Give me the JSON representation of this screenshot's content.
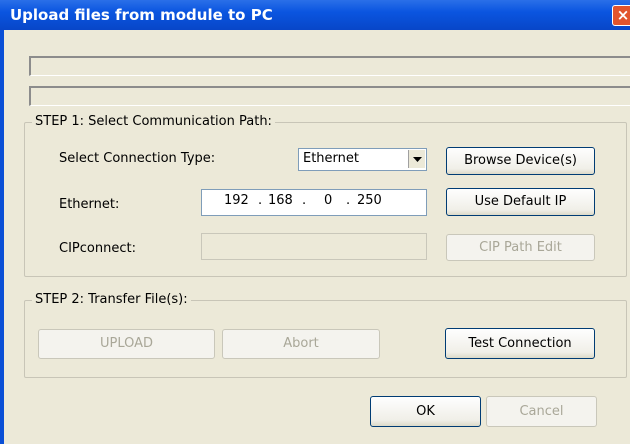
{
  "window": {
    "title": "Upload files from module to PC",
    "close_glyph": "×"
  },
  "step1": {
    "legend": "STEP 1: Select Communication Path:",
    "connection_type_label": "Select Connection Type:",
    "connection_type_value": "Ethernet",
    "browse_button": "Browse Device(s)",
    "ethernet_label": "Ethernet:",
    "ip": [
      "192",
      "168",
      "0",
      "250"
    ],
    "ip_separator": ".",
    "use_default_button": "Use Default IP",
    "cipconnect_label": "CIPconnect:",
    "cipconnect_value": "",
    "cip_path_button": "CIP Path Edit"
  },
  "step2": {
    "legend": "STEP 2: Transfer File(s):",
    "upload_button": "UPLOAD",
    "abort_button": "Abort",
    "test_button": "Test Connection"
  },
  "footer": {
    "ok_button": "OK",
    "cancel_button": "Cancel"
  },
  "colors": {
    "titlebar": "#0a55e0",
    "client": "#ece9d8",
    "close": "#e2542c"
  },
  "icons": {
    "close": "close-icon",
    "dropdown": "chevron-down-icon"
  }
}
